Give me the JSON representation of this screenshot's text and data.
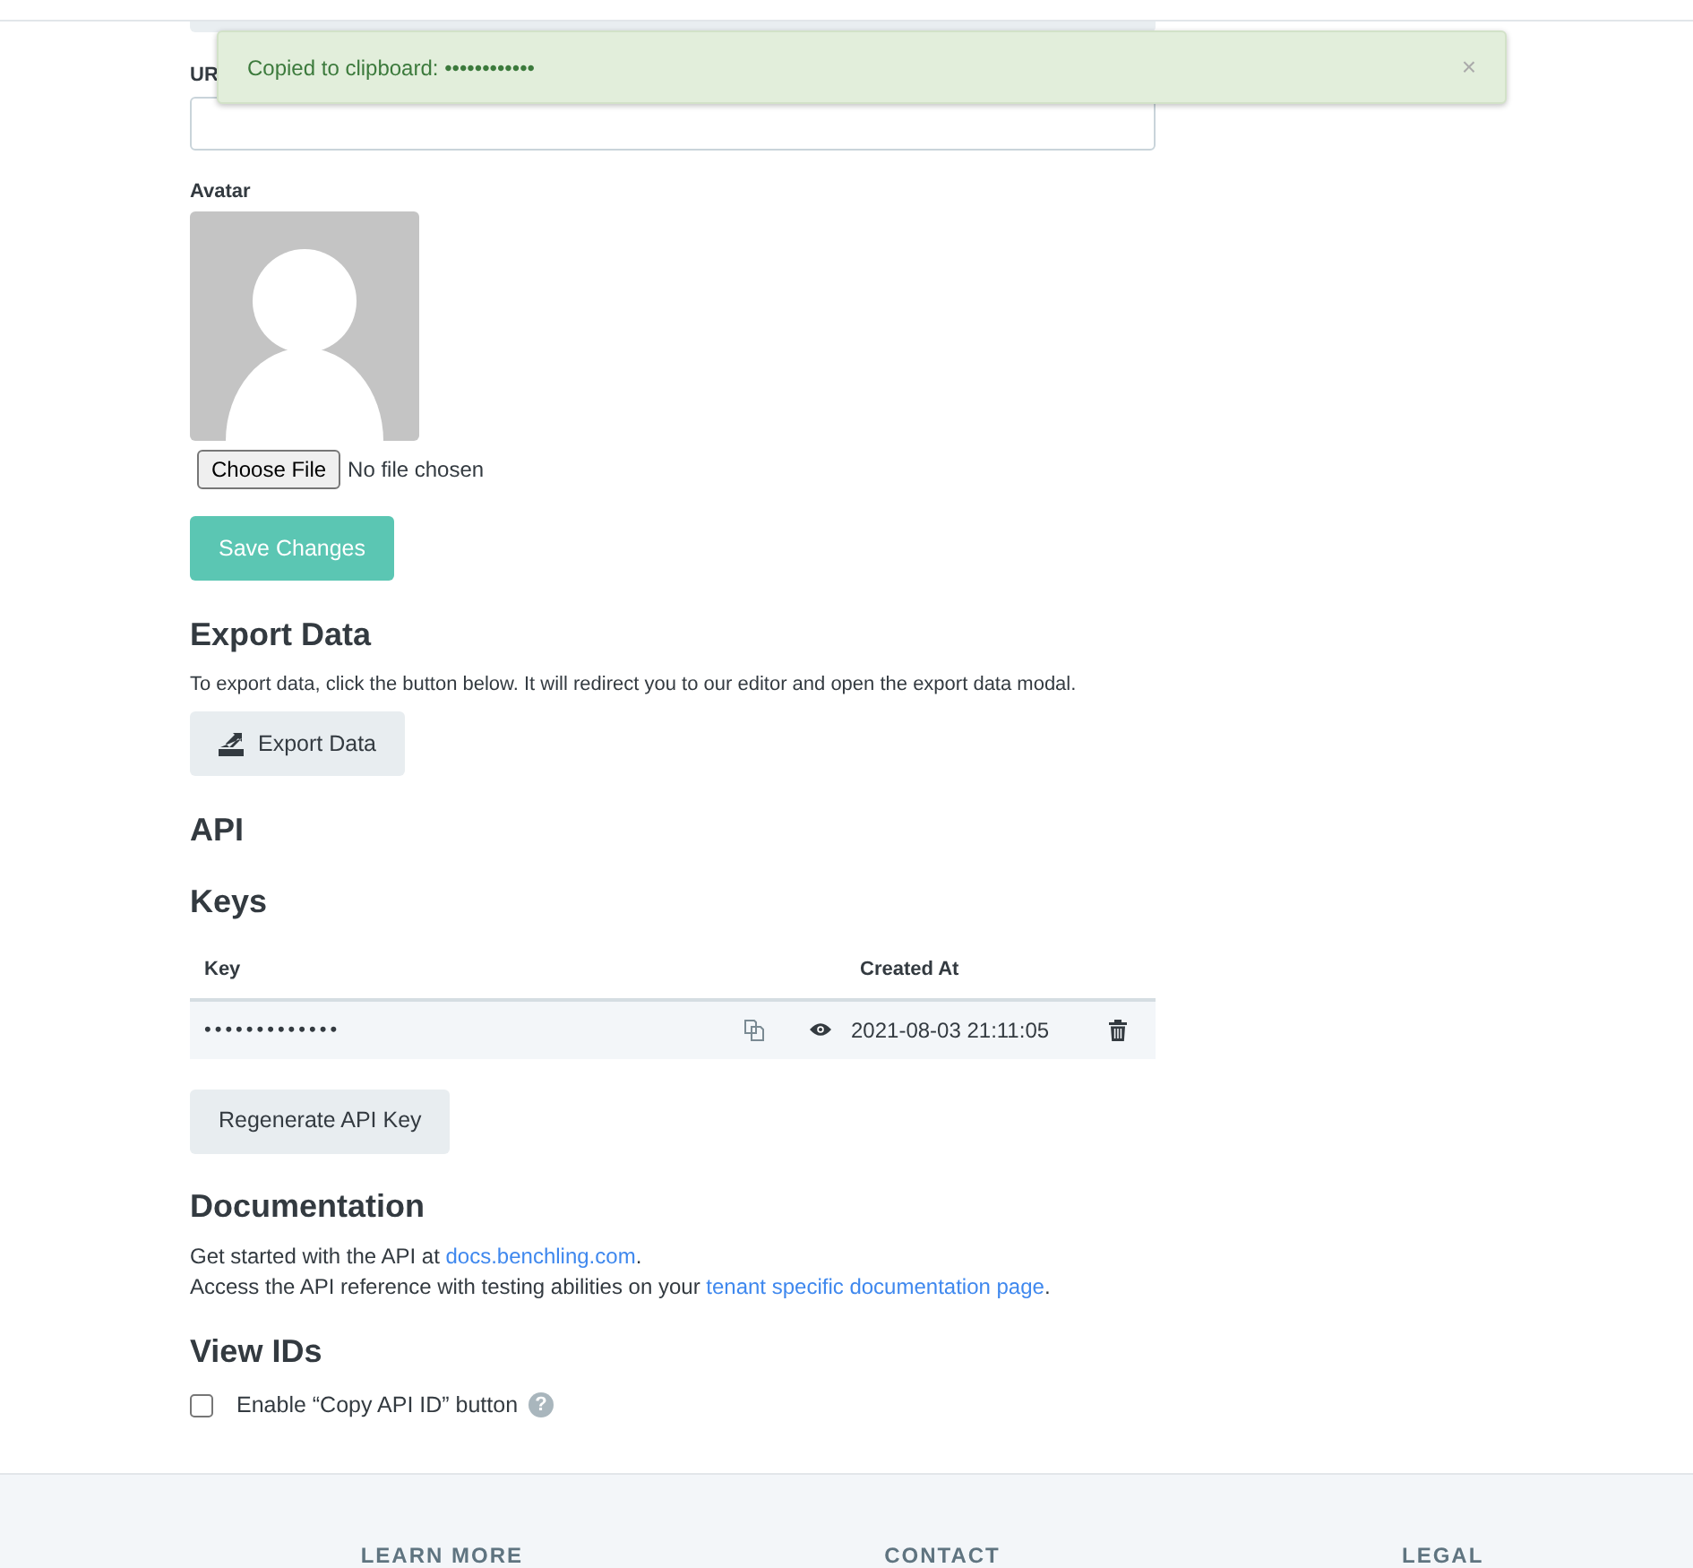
{
  "toast": {
    "message": "Copied to clipboard: ••••••••••••",
    "close": "×"
  },
  "url_field": {
    "label": "UR"
  },
  "avatar": {
    "label": "Avatar",
    "file_button": "Choose File",
    "file_status": "No file chosen"
  },
  "save_button": "Save Changes",
  "export": {
    "heading": "Export Data",
    "description": "To export data, click the button below. It will redirect you to our editor and open the export data modal.",
    "button": "Export Data"
  },
  "api": {
    "heading": "API",
    "keys_heading": "Keys",
    "table": {
      "columns": [
        "Key",
        "Created At"
      ],
      "rows": [
        {
          "key": "•••••••••••••",
          "created_at": "2021-08-03 21:11:05"
        }
      ]
    },
    "regenerate_button": "Regenerate API Key"
  },
  "documentation": {
    "heading": "Documentation",
    "lines": [
      {
        "before": "Get started with the API at ",
        "link": "docs.benchling.com",
        "after": "."
      },
      {
        "before": "Access the API reference with testing abilities on your ",
        "link": "tenant specific documentation page",
        "after": "."
      }
    ]
  },
  "view_ids": {
    "heading": "View IDs",
    "checkbox_label": "Enable “Copy API ID” button",
    "checked": false,
    "help": "?"
  },
  "footer": {
    "headings": [
      "LEARN MORE",
      "CONTACT",
      "LEGAL"
    ]
  }
}
